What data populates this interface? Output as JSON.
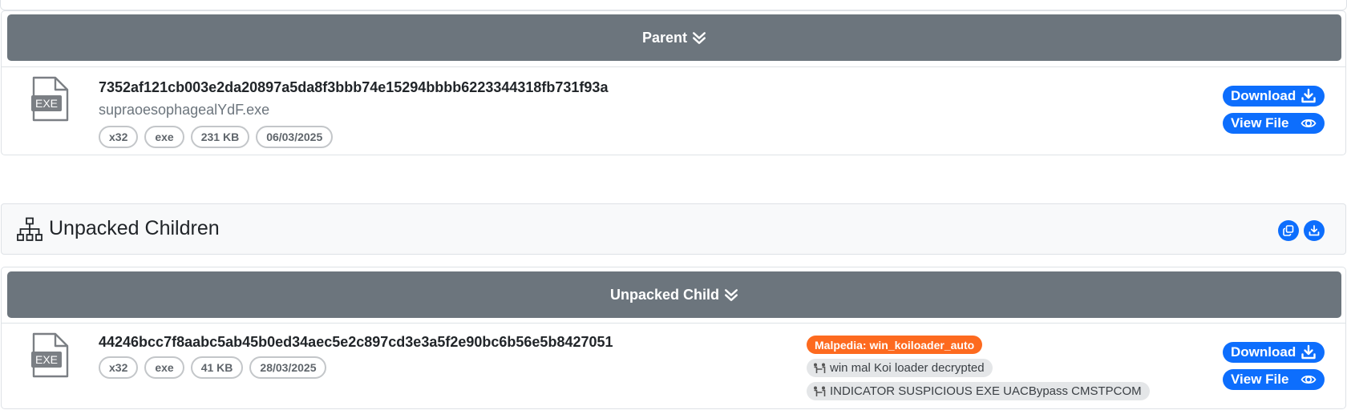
{
  "parent_section": {
    "header_label": "Parent",
    "file": {
      "icon_text": "EXE",
      "hash": "7352af121cb003e2da20897a5da8f3bbb74e15294bbbb6223344318fb731f93a",
      "filename": "supraoesophagealYdF.exe",
      "tags": [
        "x32",
        "exe",
        "231 KB",
        "06/03/2025"
      ],
      "download_label": "Download",
      "view_label": "View File"
    }
  },
  "children_bar": {
    "title": "Unpacked Children",
    "icon": "sitemap-icon",
    "buttons": [
      "copy-icon",
      "download-icon"
    ]
  },
  "child_section": {
    "header_label": "Unpacked Child",
    "file": {
      "icon_text": "EXE",
      "hash": "44246bcc7f8aabc5ab45b0ed34aec5e2c897cd3e3a5f2e90bc6b56e5b8427051",
      "tags": [
        "x32",
        "exe",
        "41 KB",
        "28/03/2025"
      ],
      "malpedia_tag": "Malpedia: win_koiloader_auto",
      "yara_tags": [
        "win mal Koi loader decrypted",
        "INDICATOR SUSPICIOUS EXE UACBypass CMSTPCOM"
      ],
      "download_label": "Download",
      "view_label": "View File"
    }
  },
  "colors": {
    "header_bg": "#6c757d",
    "primary": "#0d6efd",
    "malpedia": "#fd6a1f",
    "yara_bg": "#e4e6e8"
  }
}
